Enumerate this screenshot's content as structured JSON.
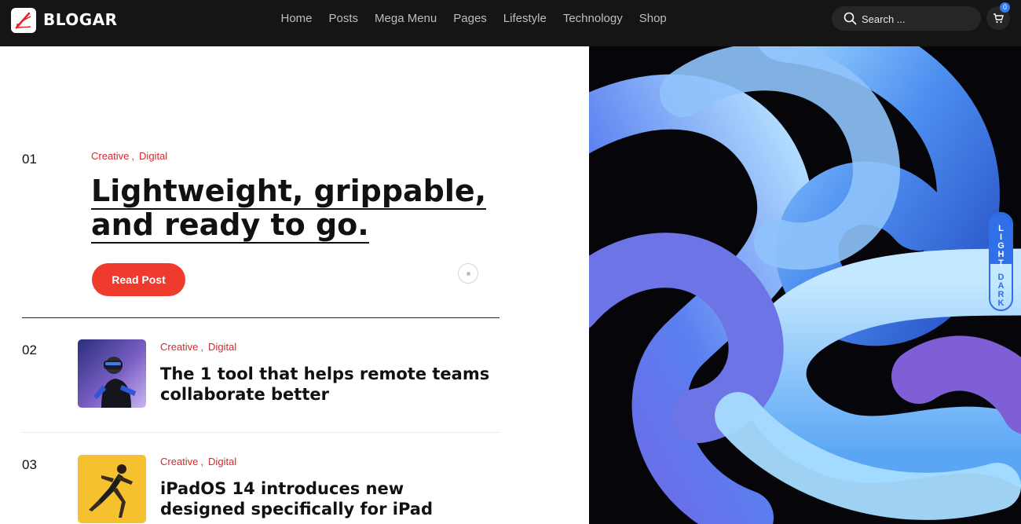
{
  "brand": {
    "name": "BLOGAR"
  },
  "nav": [
    "Home",
    "Posts",
    "Mega Menu",
    "Pages",
    "Lifestyle",
    "Technology",
    "Shop"
  ],
  "search": {
    "placeholder": "Search ..."
  },
  "cart": {
    "count": "0"
  },
  "featured": {
    "number": "01",
    "categories": [
      "Creative",
      "Digital"
    ],
    "title": "Lightweight, grippable, and ready to go.",
    "button": "Read Post"
  },
  "posts": [
    {
      "number": "02",
      "categories": [
        "Creative",
        "Digital"
      ],
      "title": "The 1 tool that helps remote teams collaborate better"
    },
    {
      "number": "03",
      "categories": [
        "Creative",
        "Digital"
      ],
      "title": "iPadOS 14 introduces new designed specifically for iPad"
    }
  ],
  "mode_toggle": {
    "light": "LIGHT",
    "dark": "DARK"
  },
  "colors": {
    "accent": "#ef3b2d",
    "category": "#d8282f",
    "toggle": "#2f6fe8",
    "header": "#151515"
  }
}
